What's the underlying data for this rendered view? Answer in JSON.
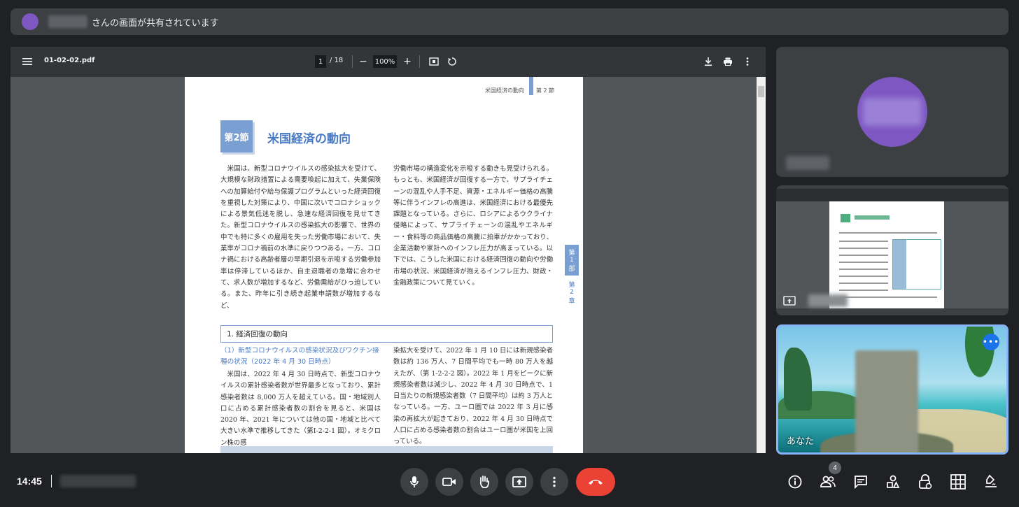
{
  "banner": {
    "text": "さんの画面が共有されています"
  },
  "pdf_viewer": {
    "filename": "01-02-02.pdf",
    "current_page": "1",
    "total_pages": "/ 18",
    "zoom": "100%"
  },
  "document": {
    "running_head": "米国経済の動向",
    "running_head_part": "第 2 節",
    "section_badge": "第2節",
    "section_title": "米国経済の動向",
    "para1_left": "　米国は、新型コロナウイルスの感染拡大を受けて、大規模な財政措置による需要喚起に加えて、失業保険への加算給付や給与保護プログラムといった経済回復を重視した対策により、中国に次いでコロナショックによる景気低迷を脱し、急速な経済回復を見せてきた。新型コロナウイルスの感染拡大の影響で、世界の中でも特に多くの雇用を失った労働市場において、失業率がコロナ禍前の水準に戻りつつある。一方、コロナ禍における高齢者層の早期引退を示唆する労働参加率は停滞しているほか、自主退職者の急増に合わせて、求人数が増加するなど、労働需給がひっ迫している。また、昨年に引き続き起業申請数が増加するなど、",
    "para1_right": "労働市場の構造変化を示唆する動きも見受けられる。もっとも、米国経済が回復する一方で、サプライチェーンの混乱や人手不足、資源・エネルギー価格の高騰等に伴うインフレの高進は、米国経済における最優先課題となっている。さらに、ロシアによるウクライナ侵略によって、サプライチェーンの混乱やエネルギー・食料等の商品価格の高騰に拍車がかかっており、企業活動や家計へのインフレ圧力が高まっている。以下では、こうした米国における経済回復の動向や労働市場の状況、米国経済が抱えるインフレ圧力、財政・金融政策について見ていく。",
    "side_tab_part": [
      "第",
      "1",
      "部"
    ],
    "side_tab_chapter": [
      "第",
      "2",
      "章"
    ],
    "subhead": "1. 経済回復の動向",
    "subsub": "（1）新型コロナウイルスの感染状況及びワクチン接種の状況（2022 年 4 月 30 日時点）",
    "para2_left": "　米国は、2022 年 4 月 30 日時点で、新型コロナウイルスの累計感染者数が世界最多となっており、累計感染者数は 8,000 万人を超えている。国・地域別人口に占める累計感染者数の割合を見ると、米国は 2020 年、2021 年については他の国・地域と比べて大きい水準で推移してきた（第Ⅰ-2-2-1 図）。オミクロン株の感",
    "para2_right": "染拡大を受けて、2022 年 1 月 10 日には新規感染者数は約 136 万人、7 日間平均でも一時 80 万人を越えたが、（第 1-2-2-2 図）。2022 年 1 月をピークに新規感染者数は減少し、2022 年 4 月 30 日時点で、1 日当たりの新規感染者数（7 日間平均）は約 3 万人となっている。一方、ユーロ圏では 2022 年 3 月に感染の再拡大が起きており、2022 年 4 月 30 日時点で人口に占める感染者数の割合はユーロ圏が米国を上回っている。"
  },
  "self_tile": {
    "label": "あなた",
    "more_label": "•••"
  },
  "bottom_bar": {
    "time": "14:45",
    "people_count": "4"
  },
  "icons": {
    "menu": "menu-icon",
    "download": "download-icon",
    "print": "print-icon",
    "mic": "mic-icon",
    "camera": "camera-icon",
    "hand": "raise-hand-icon",
    "present": "present-icon",
    "hangup": "hangup-icon"
  },
  "colors": {
    "accent_blue": "#7a9fd3",
    "hangup_red": "#ea4335",
    "active_border": "#8ab4f8",
    "avatar_purple": "#7e57c2"
  }
}
